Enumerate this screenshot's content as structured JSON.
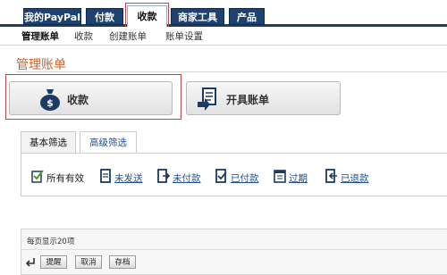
{
  "top_tabs": [
    {
      "label": "我的PayPal"
    },
    {
      "label": "付款"
    },
    {
      "label": "收款"
    },
    {
      "label": "商家工具"
    },
    {
      "label": "产品"
    }
  ],
  "sub_nav": [
    {
      "label": "管理账单"
    },
    {
      "label": "收款"
    },
    {
      "label": "创建账单"
    },
    {
      "label": "账单设置"
    }
  ],
  "page_title": "管理账单",
  "big_buttons": {
    "collect": {
      "label": "收款",
      "icon": "money-bag-icon"
    },
    "invoice": {
      "label": "开具账单",
      "icon": "invoice-document-icon"
    }
  },
  "filter_tabs": [
    {
      "label": "基本筛选"
    },
    {
      "label": "高级筛选"
    }
  ],
  "filter_links": [
    {
      "label": "所有有效",
      "icon": "check-document-icon"
    },
    {
      "label": "未发送",
      "icon": "document-icon"
    },
    {
      "label": "未付款",
      "icon": "document-arrow-icon"
    },
    {
      "label": "已付款",
      "icon": "check-document-icon"
    },
    {
      "label": "过期",
      "icon": "calendar-icon"
    },
    {
      "label": "已退款",
      "icon": "refund-document-icon"
    }
  ],
  "list": {
    "per_page": "每页显示20项",
    "actions": [
      {
        "label": "提醒"
      },
      {
        "label": "取消"
      },
      {
        "label": "存档"
      }
    ]
  },
  "colors": {
    "tab_bg": "#1d4270",
    "accent_title": "#c8642b",
    "link": "#1f4f8e",
    "highlight": "#b84a4a"
  }
}
